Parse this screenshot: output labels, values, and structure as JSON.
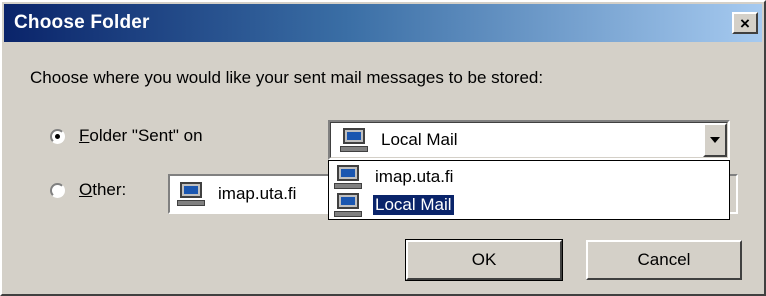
{
  "window": {
    "title": "Choose Folder",
    "close_label": "×"
  },
  "prompt": "Choose where you would like your sent mail messages to be stored:",
  "option_folder": {
    "prefix_underlined": "F",
    "label_rest": "older \"Sent\" on",
    "checked": true
  },
  "option_other": {
    "prefix_underlined": "O",
    "label_rest": "ther:",
    "checked": false
  },
  "folder_combo": {
    "selected": "Local Mail",
    "icon": "computer-icon"
  },
  "dropdown_list": {
    "items": [
      {
        "label": "imap.uta.fi",
        "selected": false
      },
      {
        "label": "Local Mail",
        "selected": true
      }
    ]
  },
  "other_field": {
    "value": "imap.uta.fi",
    "icon": "computer-icon"
  },
  "buttons": {
    "ok": "OK",
    "cancel": "Cancel"
  },
  "colors": {
    "titlebar_start": "#0a246a",
    "titlebar_end": "#a6caf0",
    "selection": "#0a246a",
    "face": "#d4d0c8"
  }
}
